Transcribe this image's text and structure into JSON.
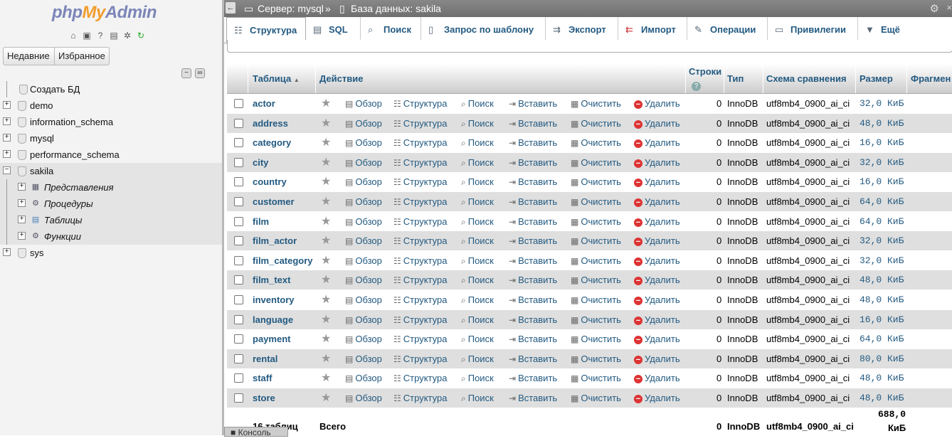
{
  "logo": {
    "php": "php",
    "my": "My",
    "admin": "Admin"
  },
  "nav": {
    "recent_label": "Недавние",
    "favorites_label": "Избранное",
    "create_db": "Создать БД",
    "databases": [
      "demo",
      "information_schema",
      "mysql",
      "performance_schema",
      "sakila"
    ],
    "sakila_children": [
      "Представления",
      "Процедуры",
      "Таблицы",
      "Функции"
    ],
    "last_db": "sys"
  },
  "breadcrumb": {
    "server": "Сервер: mysql",
    "separator": "»",
    "database": "База данных: sakila"
  },
  "tabs": [
    {
      "label": "Структура",
      "icon": "structure-icon"
    },
    {
      "label": "SQL",
      "icon": "sql-icon"
    },
    {
      "label": "Поиск",
      "icon": "search-icon"
    },
    {
      "label": "Запрос по шаблону",
      "icon": "query-icon"
    },
    {
      "label": "Экспорт",
      "icon": "export-icon"
    },
    {
      "label": "Импорт",
      "icon": "import-icon"
    },
    {
      "label": "Операции",
      "icon": "wrench-icon"
    },
    {
      "label": "Привилегии",
      "icon": "privileges-icon"
    },
    {
      "label": "Ещё",
      "icon": "chevron-down-icon"
    }
  ],
  "table": {
    "headers": {
      "table": "Таблица",
      "action": "Действие",
      "rows": "Строки",
      "type": "Тип",
      "collation": "Схема сравнения",
      "size": "Размер",
      "overhead": "Фрагмен"
    },
    "actions": {
      "browse": "Обзор",
      "structure": "Структура",
      "search": "Поиск",
      "insert": "Вставить",
      "empty": "Очистить",
      "drop": "Удалить"
    },
    "rows": [
      {
        "name": "actor",
        "rows": "0",
        "type": "InnoDB",
        "collation": "utf8mb4_0900_ai_ci",
        "size": "32,0 КиБ"
      },
      {
        "name": "address",
        "rows": "0",
        "type": "InnoDB",
        "collation": "utf8mb4_0900_ai_ci",
        "size": "48,0 КиБ"
      },
      {
        "name": "category",
        "rows": "0",
        "type": "InnoDB",
        "collation": "utf8mb4_0900_ai_ci",
        "size": "16,0 КиБ"
      },
      {
        "name": "city",
        "rows": "0",
        "type": "InnoDB",
        "collation": "utf8mb4_0900_ai_ci",
        "size": "32,0 КиБ"
      },
      {
        "name": "country",
        "rows": "0",
        "type": "InnoDB",
        "collation": "utf8mb4_0900_ai_ci",
        "size": "16,0 КиБ"
      },
      {
        "name": "customer",
        "rows": "0",
        "type": "InnoDB",
        "collation": "utf8mb4_0900_ai_ci",
        "size": "64,0 КиБ"
      },
      {
        "name": "film",
        "rows": "0",
        "type": "InnoDB",
        "collation": "utf8mb4_0900_ai_ci",
        "size": "64,0 КиБ"
      },
      {
        "name": "film_actor",
        "rows": "0",
        "type": "InnoDB",
        "collation": "utf8mb4_0900_ai_ci",
        "size": "32,0 КиБ"
      },
      {
        "name": "film_category",
        "rows": "0",
        "type": "InnoDB",
        "collation": "utf8mb4_0900_ai_ci",
        "size": "32,0 КиБ"
      },
      {
        "name": "film_text",
        "rows": "0",
        "type": "InnoDB",
        "collation": "utf8mb4_0900_ai_ci",
        "size": "48,0 КиБ"
      },
      {
        "name": "inventory",
        "rows": "0",
        "type": "InnoDB",
        "collation": "utf8mb4_0900_ai_ci",
        "size": "48,0 КиБ"
      },
      {
        "name": "language",
        "rows": "0",
        "type": "InnoDB",
        "collation": "utf8mb4_0900_ai_ci",
        "size": "16,0 КиБ"
      },
      {
        "name": "payment",
        "rows": "0",
        "type": "InnoDB",
        "collation": "utf8mb4_0900_ai_ci",
        "size": "64,0 КиБ"
      },
      {
        "name": "rental",
        "rows": "0",
        "type": "InnoDB",
        "collation": "utf8mb4_0900_ai_ci",
        "size": "80,0 КиБ"
      },
      {
        "name": "staff",
        "rows": "0",
        "type": "InnoDB",
        "collation": "utf8mb4_0900_ai_ci",
        "size": "48,0 КиБ"
      },
      {
        "name": "store",
        "rows": "0",
        "type": "InnoDB",
        "collation": "utf8mb4_0900_ai_ci",
        "size": "48,0 КиБ"
      }
    ],
    "footer": {
      "count": "16 таблиц",
      "label": "Всего",
      "rows": "0",
      "type": "InnoDB",
      "collation": "utf8mb4_0900_ai_ci",
      "size_value": "688,0",
      "size_unit": "КиБ"
    }
  },
  "console_label": "Консоль"
}
